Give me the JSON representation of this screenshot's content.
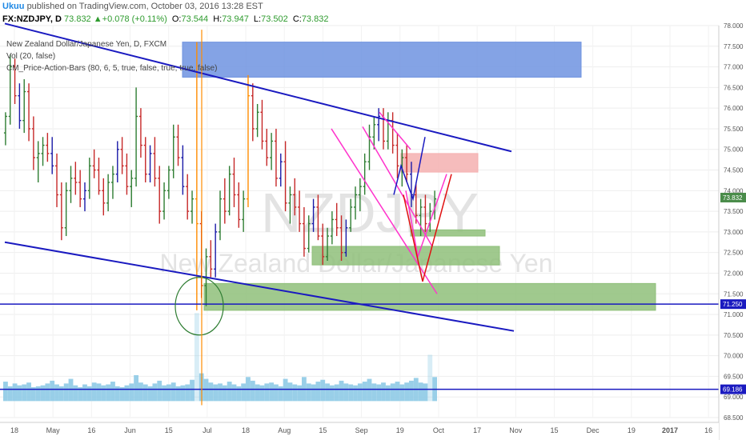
{
  "header": {
    "author": "Ukuu",
    "published_text": "published on TradingView.com, October 03, 2016 13:28 EST"
  },
  "symbol_bar": {
    "symbol": "FX:NZDJPY, D",
    "last": "73.832",
    "change": "+0.078 (+0.11%)",
    "o_label": "O:",
    "o": "73.544",
    "h_label": "H:",
    "h": "73.947",
    "l_label": "L:",
    "l": "73.502",
    "c_label": "C:",
    "c": "73.832"
  },
  "legends": {
    "instrument": "New Zealand Dollar/Japanese Yen, D, FXCM",
    "volume": "Vol (20, false)",
    "indicator": "CM_Price-Action-Bars (80, 6, 5, true, false, true, true, false)"
  },
  "watermark": {
    "symbol": "NZDJPY",
    "name": "New Zealand Dollar/Japanese Yen"
  },
  "colors": {
    "up": "#2e7d32",
    "down": "#c62828",
    "neutral_blue": "#1a1aa8",
    "orange": "#ff8c00",
    "supply_zone": "#6f93e0",
    "demand_zone": "#8fc07a",
    "resistance_zone": "#f5b0b0",
    "trendline": "#1a1ac0",
    "channel": "#ff33cc",
    "volume": "#8ecae6",
    "axis_text": "#555555"
  },
  "chart_data": {
    "type": "candlestick",
    "price_axis": {
      "ticks": [
        "78.000",
        "77.500",
        "77.000",
        "76.500",
        "76.000",
        "75.500",
        "75.000",
        "74.500",
        "74.000",
        "73.500",
        "73.000",
        "72.500",
        "72.000",
        "71.500",
        "71.000",
        "70.500",
        "70.000",
        "69.500",
        "69.000",
        "68.500"
      ],
      "ylim": [
        68.5,
        78.0
      ]
    },
    "price_labels": [
      {
        "text": "73.832",
        "value": 73.832,
        "color": "#4a8c4a"
      },
      {
        "text": "71.250",
        "value": 71.25,
        "color": "#1a1ac0"
      },
      {
        "text": "69.186",
        "value": 69.186,
        "color": "#1a1ac0"
      }
    ],
    "time_axis": {
      "ticks": [
        "18",
        "May",
        "16",
        "Jun",
        "15",
        "Jul",
        "18",
        "Aug",
        "15",
        "Sep",
        "19",
        "Oct",
        "17",
        "Nov",
        "15",
        "Dec",
        "19",
        "2017",
        "16"
      ],
      "range": [
        "2016-04-18",
        "2017-01-16"
      ]
    },
    "horizontal_lines": [
      71.25,
      69.186
    ],
    "candles_ohlc": [
      [
        75.4,
        75.9,
        75.1,
        75.8
      ],
      [
        75.8,
        77.3,
        75.6,
        77.0
      ],
      [
        77.0,
        77.2,
        76.1,
        76.3
      ],
      [
        76.3,
        76.6,
        75.5,
        75.7
      ],
      [
        75.7,
        76.7,
        75.4,
        76.4
      ],
      [
        76.4,
        76.6,
        75.2,
        75.5
      ],
      [
        75.5,
        75.8,
        74.5,
        74.8
      ],
      [
        74.8,
        75.2,
        74.2,
        74.9
      ],
      [
        74.9,
        75.3,
        74.6,
        75.1
      ],
      [
        75.1,
        75.4,
        74.7,
        74.9
      ],
      [
        74.9,
        75.3,
        74.4,
        74.6
      ],
      [
        74.6,
        74.9,
        73.6,
        73.9
      ],
      [
        73.9,
        74.2,
        72.8,
        73.1
      ],
      [
        73.1,
        74.2,
        72.9,
        74.0
      ],
      [
        74.0,
        74.6,
        73.7,
        74.3
      ],
      [
        74.3,
        74.7,
        73.9,
        74.2
      ],
      [
        74.2,
        74.5,
        73.6,
        73.8
      ],
      [
        73.8,
        74.2,
        73.5,
        74.0
      ],
      [
        74.0,
        74.8,
        73.8,
        74.6
      ],
      [
        74.6,
        75.0,
        74.3,
        74.5
      ],
      [
        74.5,
        74.8,
        73.9,
        74.0
      ],
      [
        74.0,
        74.3,
        73.4,
        73.7
      ],
      [
        73.7,
        74.4,
        73.5,
        74.2
      ],
      [
        74.2,
        74.6,
        73.8,
        74.4
      ],
      [
        74.4,
        75.2,
        74.2,
        75.0
      ],
      [
        75.0,
        75.3,
        74.4,
        74.6
      ],
      [
        74.6,
        74.9,
        73.9,
        74.1
      ],
      [
        74.1,
        74.5,
        73.6,
        74.3
      ],
      [
        74.3,
        76.5,
        74.1,
        75.8
      ],
      [
        75.8,
        76.0,
        74.8,
        75.1
      ],
      [
        75.1,
        75.3,
        74.2,
        74.4
      ],
      [
        74.4,
        75.1,
        74.2,
        74.9
      ],
      [
        74.9,
        75.3,
        74.1,
        74.3
      ],
      [
        74.3,
        74.6,
        73.2,
        73.5
      ],
      [
        73.5,
        74.2,
        73.3,
        74.0
      ],
      [
        74.0,
        74.6,
        73.8,
        74.5
      ],
      [
        74.5,
        75.6,
        74.3,
        75.3
      ],
      [
        75.3,
        75.6,
        74.6,
        74.8
      ],
      [
        74.8,
        75.1,
        73.9,
        74.1
      ],
      [
        74.1,
        74.4,
        73.3,
        73.5
      ],
      [
        73.5,
        74.0,
        73.2,
        73.8
      ],
      [
        73.8,
        77.6,
        71.1,
        73.2
      ],
      [
        73.2,
        73.5,
        71.4,
        71.7
      ],
      [
        71.7,
        72.6,
        71.2,
        72.4
      ],
      [
        72.4,
        72.8,
        71.9,
        72.1
      ],
      [
        72.1,
        73.2,
        71.9,
        73.0
      ],
      [
        73.0,
        74.0,
        72.8,
        73.8
      ],
      [
        73.8,
        74.3,
        73.2,
        73.5
      ],
      [
        73.5,
        74.6,
        73.4,
        74.4
      ],
      [
        74.4,
        74.8,
        73.6,
        73.9
      ],
      [
        73.9,
        74.2,
        73.1,
        73.3
      ],
      [
        73.3,
        74.0,
        73.0,
        73.8
      ],
      [
        73.8,
        76.8,
        73.6,
        76.3
      ],
      [
        76.3,
        76.6,
        75.2,
        75.5
      ],
      [
        75.5,
        76.1,
        75.3,
        75.9
      ],
      [
        75.9,
        76.2,
        75.0,
        75.2
      ],
      [
        75.2,
        75.5,
        74.6,
        74.8
      ],
      [
        74.8,
        75.4,
        74.5,
        75.2
      ],
      [
        75.2,
        75.5,
        74.1,
        74.3
      ],
      [
        74.3,
        74.9,
        74.1,
        74.7
      ],
      [
        74.7,
        75.2,
        73.5,
        73.7
      ],
      [
        73.7,
        74.1,
        73.2,
        73.9
      ],
      [
        73.9,
        74.3,
        73.4,
        73.6
      ],
      [
        73.6,
        74.0,
        73.0,
        73.2
      ],
      [
        73.2,
        73.6,
        72.4,
        72.6
      ],
      [
        72.6,
        73.4,
        72.5,
        73.2
      ],
      [
        73.2,
        73.8,
        73.0,
        73.6
      ],
      [
        73.6,
        73.9,
        72.8,
        72.9
      ],
      [
        72.9,
        73.2,
        72.2,
        72.4
      ],
      [
        72.4,
        73.1,
        72.3,
        72.9
      ],
      [
        72.9,
        73.5,
        72.7,
        73.3
      ],
      [
        73.3,
        73.7,
        72.9,
        73.1
      ],
      [
        73.1,
        73.4,
        72.3,
        72.5
      ],
      [
        72.5,
        73.3,
        72.4,
        73.1
      ],
      [
        73.1,
        73.8,
        73.0,
        73.6
      ],
      [
        73.6,
        74.1,
        73.3,
        73.9
      ],
      [
        73.9,
        74.3,
        73.5,
        74.1
      ],
      [
        74.1,
        74.9,
        73.9,
        74.7
      ],
      [
        74.7,
        75.6,
        74.5,
        75.3
      ],
      [
        75.3,
        75.8,
        75.0,
        75.6
      ],
      [
        75.6,
        76.0,
        75.2,
        75.8
      ],
      [
        75.8,
        76.0,
        75.0,
        75.2
      ],
      [
        75.2,
        75.9,
        75.0,
        75.7
      ],
      [
        75.7,
        75.9,
        74.9,
        75.1
      ],
      [
        75.1,
        75.4,
        74.3,
        74.6
      ],
      [
        74.6,
        75.0,
        74.1,
        74.8
      ],
      [
        74.8,
        75.1,
        74.2,
        74.4
      ],
      [
        74.4,
        74.7,
        73.6,
        73.9
      ],
      [
        73.9,
        74.2,
        73.2,
        73.4
      ],
      [
        73.4,
        73.8,
        72.9,
        73.6
      ],
      [
        73.6,
        73.9,
        73.0,
        73.2
      ],
      [
        73.2,
        73.7,
        73.0,
        73.5
      ],
      [
        73.5,
        74.0,
        73.3,
        73.8
      ]
    ],
    "zones": [
      {
        "kind": "supply",
        "date_from": "2016-06-27",
        "date_to": "2016-12-10",
        "price_from": 76.75,
        "price_to": 77.6
      },
      {
        "kind": "resistance",
        "date_from": "2016-09-26",
        "date_to": "2016-10-28",
        "price_from": 74.45,
        "price_to": 74.9
      },
      {
        "kind": "demand",
        "date_from": "2016-09-30",
        "date_to": "2016-10-31",
        "price_from": 72.9,
        "price_to": 73.05
      },
      {
        "kind": "demand",
        "date_from": "2016-08-20",
        "date_to": "2016-11-06",
        "price_from": 72.2,
        "price_to": 72.65
      },
      {
        "kind": "demand",
        "date_from": "2016-07-06",
        "date_to": "2017-01-10",
        "price_from": 71.1,
        "price_to": 71.75
      }
    ],
    "volume": [
      2.1,
      1.6,
      1.9,
      1.7,
      1.8,
      2.0,
      1.5,
      1.6,
      1.7,
      1.9,
      2.2,
      1.8,
      1.6,
      1.9,
      2.4,
      1.7,
      1.5,
      1.8,
      1.6,
      2.0,
      1.9,
      1.7,
      1.8,
      2.1,
      1.6,
      1.5,
      1.7,
      1.9,
      2.8,
      2.0,
      1.8,
      1.6,
      1.9,
      2.2,
      1.7,
      1.8,
      2.0,
      1.6,
      1.7,
      1.8,
      2.3,
      9.5,
      3.0,
      2.4,
      2.0,
      1.8,
      1.9,
      1.7,
      2.1,
      1.8,
      1.6,
      1.9,
      2.6,
      2.2,
      1.8,
      1.7,
      1.9,
      2.0,
      1.8,
      1.6,
      2.4,
      2.0,
      1.8,
      1.7,
      2.6,
      1.9,
      1.8,
      2.1,
      2.3,
      1.9,
      1.7,
      1.8,
      2.2,
      1.9,
      1.8,
      1.7,
      1.9,
      2.1,
      2.4,
      1.9,
      1.8,
      2.0,
      1.7,
      1.9,
      2.1,
      1.8,
      2.0,
      2.2,
      2.5,
      2.0,
      1.9,
      5.0,
      2.6
    ]
  }
}
